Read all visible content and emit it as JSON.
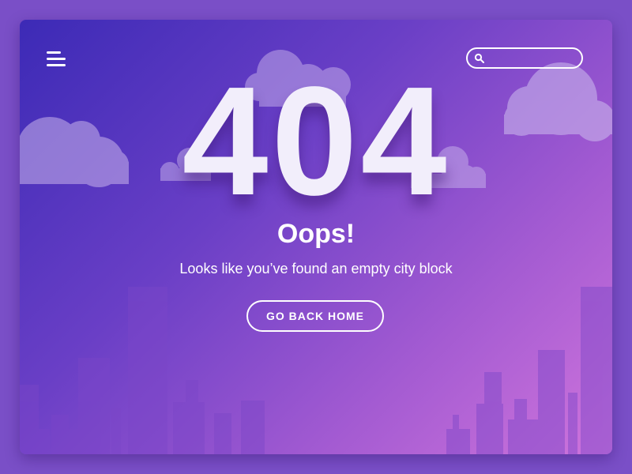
{
  "header": {
    "menu_icon": "hamburger-menu-icon",
    "search": {
      "icon": "search-icon",
      "value": "",
      "placeholder": ""
    }
  },
  "error": {
    "code": "404",
    "headline": "Oops!",
    "message": "Looks like you’ve found an empty city block",
    "home_button_label": "GO BACK HOME"
  },
  "colors": {
    "page_background": "#7a4fc7",
    "gradient_start": "#3c2ab6",
    "gradient_end": "#cf74dc",
    "text": "#ffffff",
    "cloud": "#c9b4ec",
    "building": "#7b46c8"
  }
}
